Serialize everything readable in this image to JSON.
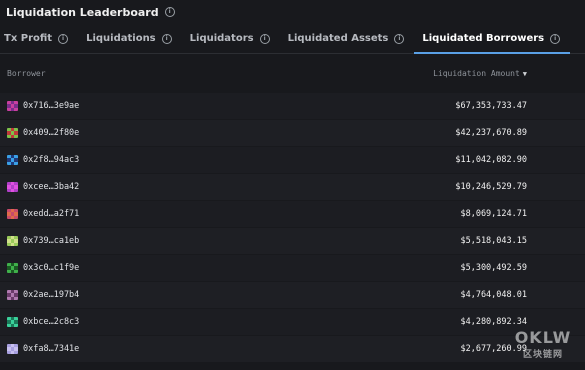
{
  "header": {
    "title": "Liquidation Leaderboard"
  },
  "tabs": [
    {
      "label": "Tx Profit",
      "active": false
    },
    {
      "label": "Liquidations",
      "active": false
    },
    {
      "label": "Liquidators",
      "active": false
    },
    {
      "label": "Liquidated Assets",
      "active": false
    },
    {
      "label": "Liquidated Borrowers",
      "active": true
    }
  ],
  "columns": {
    "borrower": "Borrower",
    "amount": "Liquidation Amount"
  },
  "rows": [
    {
      "address": "0x716…3e9ae",
      "amount": "$67,353,733.47",
      "colors": [
        "#c83fa0",
        "#7a2e8c",
        "#c83fa0"
      ]
    },
    {
      "address": "0x409…2f80e",
      "amount": "$42,237,670.89",
      "colors": [
        "#7ec14a",
        "#c03a3a",
        "#7ec14a"
      ]
    },
    {
      "address": "0x2f8…94ac3",
      "amount": "$11,042,082.90",
      "colors": [
        "#3aa0e6",
        "#1f3a7a",
        "#3aa0e6"
      ]
    },
    {
      "address": "0xcee…3ba42",
      "amount": "$10,246,529.79",
      "colors": [
        "#b040c8",
        "#e050e0",
        "#b040c8"
      ]
    },
    {
      "address": "0xedd…a2f71",
      "amount": "$8,069,124.71",
      "colors": [
        "#c84a6a",
        "#e06a4a",
        "#c84a6a"
      ]
    },
    {
      "address": "0x739…ca1eb",
      "amount": "$5,518,043.15",
      "colors": [
        "#9acb5a",
        "#d0e08a",
        "#9acb5a"
      ]
    },
    {
      "address": "0x3c0…c1f9e",
      "amount": "$5,300,492.59",
      "colors": [
        "#3fb04a",
        "#1a5a22",
        "#3fb04a"
      ]
    },
    {
      "address": "0x2ae…197b4",
      "amount": "$4,764,048.01",
      "colors": [
        "#b07ab0",
        "#6a3a6a",
        "#b07ab0"
      ]
    },
    {
      "address": "0xbce…2c8c3",
      "amount": "$4,280,892.34",
      "colors": [
        "#3ad09a",
        "#1a7a5a",
        "#3ad09a"
      ]
    },
    {
      "address": "0xfa8…7341e",
      "amount": "$2,677,260.99",
      "colors": [
        "#a8a0e0",
        "#c8c0f0",
        "#a8a0e0"
      ]
    }
  ],
  "watermark": {
    "logo": "OKLW",
    "sub": "区块链网"
  }
}
